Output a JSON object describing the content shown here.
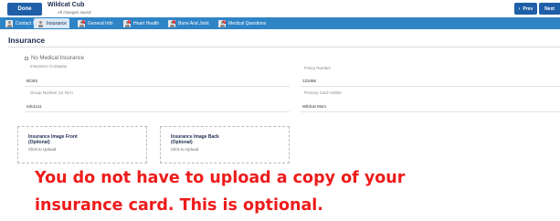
{
  "header": {
    "done_label": "Done",
    "student_name": "Wildcat Cub",
    "save_status": "All changes saved",
    "prev_label": "Prev",
    "next_label": "Next"
  },
  "tabs": [
    {
      "label": "Contact Info",
      "badge": ""
    },
    {
      "label": "Insurance",
      "badge": ""
    },
    {
      "label": "General Info",
      "badge": "5"
    },
    {
      "label": "Heart Health",
      "badge": "12"
    },
    {
      "label": "Bone And Joint",
      "badge": "8"
    },
    {
      "label": "Medical Questions",
      "badge": "26"
    }
  ],
  "section": {
    "title": "Insurance",
    "no_medical_label": "No Medical Insurance"
  },
  "fields": {
    "insurance_company": {
      "label": "Insurance Company",
      "value": "BCBS"
    },
    "policy_number": {
      "label": "Policy Number",
      "value": "123456"
    },
    "group_number": {
      "label": "Group Number (or N/A)",
      "value": "edu1111"
    },
    "primary_holder": {
      "label": "Primary Card Holder",
      "value": "Wildcat Mom"
    }
  },
  "uploads": {
    "front": {
      "title_line1": "Insurance Image Front",
      "title_line2": "(Optional)",
      "hint": "Click to Upload"
    },
    "back": {
      "title_line1": "Insurance Image Back",
      "title_line2": "(Optional)",
      "hint": "Click to Upload"
    }
  },
  "note": {
    "line1": "You do not have to upload a copy of your",
    "line2": "insurance card.  This is optional."
  },
  "colors": {
    "primary_button": "#1f5fa8",
    "tab_bar": "#2f84c6",
    "badge": "#d9262b",
    "note_text": "#ee1b1b"
  }
}
